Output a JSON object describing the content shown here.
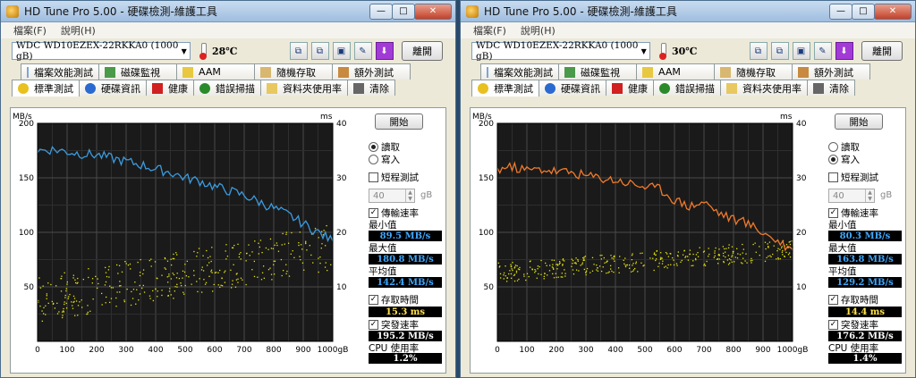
{
  "windows": [
    {
      "title": "HD Tune Pro  5.00 - 硬碟檢測-維護工具",
      "menu": [
        "檔案(F)",
        "說明(H)"
      ],
      "drive": "WDC WD10EZEX-22RKKA0 (1000 gB)",
      "temperature": "28℃",
      "exit_label": "離開",
      "tabs_row1": [
        "檔案效能測試",
        "磁碟監視",
        "AAM",
        "隨機存取",
        "額外測試"
      ],
      "tabs_row2": [
        "標準測試",
        "硬碟資訊",
        "健康",
        "錯誤掃描",
        "資料夾使用率",
        "清除"
      ],
      "start_label": "開始",
      "read_label": "讀取",
      "write_label": "寫入",
      "read_selected": true,
      "short_test_label": "短程測試",
      "short_value": "40",
      "gb_unit": "gB",
      "transfer_label": "傳輸速率",
      "min_label": "最小值",
      "min_value": "89.5 MB/s",
      "max_label": "最大值",
      "max_value": "180.8 MB/s",
      "avg_label": "平均值",
      "avg_value": "142.4 MB/s",
      "access_label": "存取時間",
      "access_value": "15.3 ms",
      "burst_label": "突發速率",
      "burst_value": "195.2 MB/s",
      "cpu_label": "CPU 使用率",
      "cpu_value": "1.2%"
    },
    {
      "title": "HD Tune Pro  5.00 - 硬碟檢測-維護工具",
      "menu": [
        "檔案(F)",
        "說明(H)"
      ],
      "drive": "WDC WD10EZEX-22RKKA0 (1000 gB)",
      "temperature": "30℃",
      "exit_label": "離開",
      "tabs_row1": [
        "檔案效能測試",
        "磁碟監視",
        "AAM",
        "隨機存取",
        "額外測試"
      ],
      "tabs_row2": [
        "標準測試",
        "硬碟資訊",
        "健康",
        "錯誤掃描",
        "資料夾使用率",
        "清除"
      ],
      "start_label": "開始",
      "read_label": "讀取",
      "write_label": "寫入",
      "read_selected": false,
      "short_test_label": "短程測試",
      "short_value": "40",
      "gb_unit": "gB",
      "transfer_label": "傳輸速率",
      "min_label": "最小值",
      "min_value": "80.3 MB/s",
      "max_label": "最大值",
      "max_value": "163.8 MB/s",
      "avg_label": "平均值",
      "avg_value": "129.2 MB/s",
      "access_label": "存取時間",
      "access_value": "14.4 ms",
      "burst_label": "突發速率",
      "burst_value": "176.2 MB/s",
      "cpu_label": "CPU 使用率",
      "cpu_value": "1.4%"
    }
  ],
  "chart_data": [
    {
      "type": "line",
      "ylabel": "MB/s",
      "y2label": "ms",
      "ylim": [
        0,
        200
      ],
      "y2lim": [
        0,
        40
      ],
      "yticks": [
        "200",
        "150",
        "100",
        "50"
      ],
      "y2ticks": [
        "40",
        "30",
        "20",
        "10"
      ],
      "xticks": [
        "0",
        "100",
        "200",
        "300",
        "400",
        "500",
        "600",
        "700",
        "800",
        "900",
        "1000gB"
      ],
      "xlim": [
        0,
        1000
      ],
      "grid": true,
      "series": [
        {
          "color": "#3a9be0",
          "x": [
            0,
            50,
            100,
            150,
            200,
            250,
            300,
            350,
            400,
            450,
            500,
            550,
            600,
            650,
            700,
            750,
            800,
            850,
            900,
            950,
            1000
          ],
          "y": [
            175,
            176,
            174,
            172,
            171,
            168,
            165,
            162,
            158,
            155,
            150,
            147,
            142,
            138,
            134,
            128,
            122,
            116,
            108,
            100,
            92
          ]
        }
      ],
      "access_color": "#e6e60f",
      "access_ms_range": [
        6,
        20
      ]
    },
    {
      "type": "line",
      "ylabel": "MB/s",
      "y2label": "ms",
      "ylim": [
        0,
        200
      ],
      "y2lim": [
        0,
        40
      ],
      "yticks": [
        "200",
        "150",
        "100",
        "50"
      ],
      "y2ticks": [
        "40",
        "30",
        "20",
        "10"
      ],
      "xticks": [
        "0",
        "100",
        "200",
        "300",
        "400",
        "500",
        "600",
        "700",
        "800",
        "900",
        "1000gB"
      ],
      "xlim": [
        0,
        1000
      ],
      "grid": true,
      "series": [
        {
          "color": "#f07a2a",
          "x": [
            0,
            50,
            100,
            150,
            200,
            250,
            300,
            350,
            400,
            450,
            500,
            550,
            600,
            650,
            700,
            750,
            800,
            850,
            900,
            950,
            1000
          ],
          "y": [
            158,
            160,
            157,
            158,
            156,
            155,
            152,
            150,
            148,
            145,
            142,
            140,
            130,
            124,
            128,
            118,
            112,
            108,
            100,
            92,
            84
          ]
        }
      ],
      "access_color": "#e6e60f",
      "access_ms_range": [
        12,
        18
      ]
    }
  ]
}
